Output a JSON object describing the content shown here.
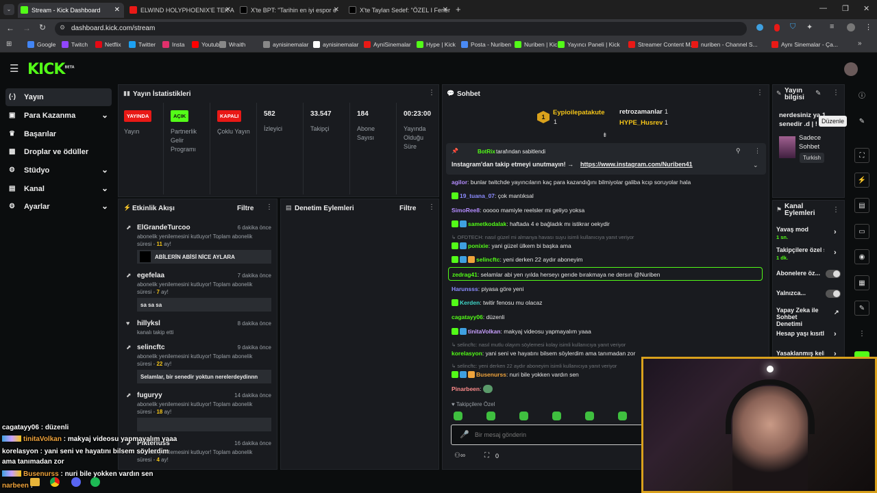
{
  "browser": {
    "tabs": [
      {
        "label": "Stream - Kick Dashboard",
        "active": true
      },
      {
        "label": "ELWIND HOLYPHOENIX'E TEK A"
      },
      {
        "label": "X'te BPT: \"Tarihin en iyi espor o"
      },
      {
        "label": "X'te Taylan Sedef: \"ÖZEL I Fener"
      }
    ],
    "url": "dashboard.kick.com/stream",
    "bookmarks": [
      "Google",
      "Twitch",
      "Netflix",
      "Twitter",
      "Insta",
      "Youtube",
      "Wraith",
      "aynisinemalar",
      "aynisinemalar",
      "AyniSinemalar",
      "Hype | Kick",
      "Posta - Nuriben",
      "Nuriben | Kick",
      "Yayıncı Paneli | Kick",
      "Streamer Content M...",
      "nuriben - Channel S...",
      "Aynı Sinemalar - Ça..."
    ]
  },
  "kick": {
    "logo": "KICK",
    "logo_sup": "BETA"
  },
  "sidebar": {
    "items": [
      {
        "label": "Yayın",
        "icon": "broadcast-icon"
      },
      {
        "label": "Para Kazanma",
        "icon": "money-icon"
      },
      {
        "label": "Başarılar",
        "icon": "trophy-icon"
      },
      {
        "label": "Droplar ve ödüller",
        "icon": "gift-icon"
      },
      {
        "label": "Stüdyo",
        "icon": "studio-icon"
      },
      {
        "label": "Kanal",
        "icon": "channel-icon"
      },
      {
        "label": "Ayarlar",
        "icon": "gear-icon"
      }
    ]
  },
  "stats": {
    "title": "Yayın İstatistikleri",
    "badges": [
      {
        "value": "YAYINDA",
        "label": "Yayın"
      },
      {
        "value": "AÇIK",
        "label": "Partnerlik Gelir Programı"
      },
      {
        "value": "KAPALI",
        "label": "Çoklu Yayın"
      }
    ],
    "numbers": [
      {
        "value": "582",
        "label": "İzleyici"
      },
      {
        "value": "33.547",
        "label": "Takipçi"
      },
      {
        "value": "184",
        "label": "Abone Sayısı"
      },
      {
        "value": "00:23:00",
        "label": "Yayında Olduğu Süre"
      }
    ]
  },
  "activity": {
    "title": "Etkinlik Akışı",
    "filter": "Filtre",
    "events": [
      {
        "name": "ElGrandeTurcoo",
        "time": "6 dakika önce",
        "desc": "abonelik yenilemesini kutluyor! Toplam abonelik süresi - ",
        "months": "11",
        "suffix": " ay!",
        "msg": "ABİLERİN ABİSİ NİCE AYLARA"
      },
      {
        "name": "egefelaa",
        "time": "7 dakika önce",
        "desc": "abonelik yenilemesini kutluyor! Toplam abonelik süresi - ",
        "months": "7",
        "suffix": " ay!",
        "msg": "sa sa sa"
      },
      {
        "name": "hillyksl",
        "time": "8 dakika önce",
        "desc": "kanalı takip etti"
      },
      {
        "name": "selincftc",
        "time": "9 dakika önce",
        "desc": "abonelik yenilemesini kutluyor! Toplam abonelik süresi - ",
        "months": "22",
        "suffix": " ay!",
        "msg": "Selamlar, bir senedir yoktun nerelerdeydinnn"
      },
      {
        "name": "fuguryy",
        "time": "14 dakika önce",
        "desc": "abonelik yenilemesini kutluyor! Toplam abonelik süresi - ",
        "months": "18",
        "suffix": " ay!"
      },
      {
        "name": "Pikteriuss",
        "time": "16 dakika önce",
        "desc": "abonelik yenilemesini kutluyor! Toplam abonelik süresi - ",
        "months": "4",
        "suffix": " ay!"
      }
    ]
  },
  "moderation": {
    "title": "Denetim Eylemleri",
    "filter": "Filtre"
  },
  "chat": {
    "title": "Sohbet",
    "top": [
      {
        "name": "Eypioilepatakute",
        "count": "1"
      },
      {
        "name": "retrozamanlar",
        "count": "1"
      },
      {
        "name": "HYPE_Husrev",
        "count": "1"
      }
    ],
    "pinned_by": "BotRix",
    "pinned_suffix": "tarafından sabitlendi",
    "pinned_text": "Instagram'dan takip etmeyi unutmayın! →",
    "pinned_link": "https://www.instagram.com/Nuriben41",
    "messages": [
      {
        "user": "agilor",
        "color": "#b48cff",
        "text": "bunlar twitchde yayıncıların kaç para kazandığını bilmiyolar galiba kcıp soruyolar hala"
      },
      {
        "user": "19_tuana_07",
        "color": "#8c8cff",
        "text": "çok mantıksal"
      },
      {
        "user": "SimoRee8",
        "color": "#b48cff",
        "text": "ooooo mamiyle reelsler mi geliyo yoksa"
      },
      {
        "user": "sametkodalak",
        "color": "#53fc18",
        "text": "haftada 4 e bağladık mı istikrar oekydir"
      },
      {
        "reply": "OFDTECH: nasıl güzel mi almanya havası suyu isimli kullanıcıya yanıt veriyor"
      },
      {
        "user": "ponixie",
        "color": "#53fc18",
        "text": "yani güzel ülkem bi başka ama"
      },
      {
        "user": "selincftc",
        "color": "#53fc18",
        "text": "yeni derken 22 aydır aboneyim"
      },
      {
        "user": "zedrag41",
        "color": "#53fc18",
        "text": "selamlar abi yen ıyılda herseyı gerıde bırakmaya ne dersın @Nuriben",
        "highlight": true
      },
      {
        "user": "Harunsss",
        "color": "#8c8cff",
        "text": "piyasa göre yeni"
      },
      {
        "user": "Kerden",
        "color": "#3fd7c8",
        "text": "twitir fenosu mu olacaz"
      },
      {
        "user": "cagatayy06",
        "color": "#53fc18",
        "text": "düzenli"
      },
      {
        "user": "tinitaVolkan",
        "color": "#c8a0ff",
        "text": "makyaj videosu yapmayalım yaaa"
      },
      {
        "reply": "selincftc: nasıl mutlu olayım söylemesi kolay isimli kullanıcıya yanıt veriyor"
      },
      {
        "user": "korelasyon",
        "color": "#53fc18",
        "text": "yani seni ve hayatını bilsem söylerdim ama tanımadan zor"
      },
      {
        "reply": "selincftc: yeni derken 22 aydır aboneyim isimli kullanıcıya yanıt veriyor"
      },
      {
        "user": "Busenurss",
        "color": "#f0a43c",
        "text": "nuri bile yokken vardın sen"
      },
      {
        "user": "Pinarbeen",
        "color": "#ff8c8c",
        "text": ""
      }
    ],
    "followers_only": "Takipçilere Özel",
    "placeholder": "Bir mesaj gönderin",
    "count": "0"
  },
  "stream_info": {
    "title": "Yayın bilgisi",
    "tooltip": "Düzenle",
    "stream_title": "nerdesiniz ya 1 senedir .d | !",
    "category": "Sadece Sohbet",
    "language": "Turkish"
  },
  "channel_actions": {
    "title": "Kanal Eylemleri",
    "items": [
      {
        "label": "Yavaş mod",
        "sub": "1 sn."
      },
      {
        "label": "Takipçilere özel s",
        "sub": "1 dk."
      },
      {
        "label": "Abonelere öz..."
      },
      {
        "label": "Yalnızca..."
      },
      {
        "label": "Yapay Zeka ile Sohbet Denetimi"
      },
      {
        "label": "Hesap yaşı kısıtla"
      },
      {
        "label": "Yasaklanmış kelin"
      }
    ]
  },
  "overlay": {
    "lines": [
      {
        "user": "cagatayy06",
        "text": " : düzenli"
      },
      {
        "user": "tinitaVolkan",
        "text": " : makyaj videosu yapmayalım yaaa"
      },
      {
        "user": "korelasyon",
        "text": " : yani seni ve hayatını bilsem söylerdim"
      },
      {
        "user": "",
        "text": "ama tanımadan zor"
      },
      {
        "user": "Busenurss",
        "text": " : nuri bile yokken vardın sen"
      },
      {
        "user": "narbeen",
        "text": " :"
      }
    ]
  },
  "colors": {
    "accent": "#53fc18",
    "bg": "#0b0d0e",
    "panel": "#191b1f",
    "live": "#e91916"
  }
}
